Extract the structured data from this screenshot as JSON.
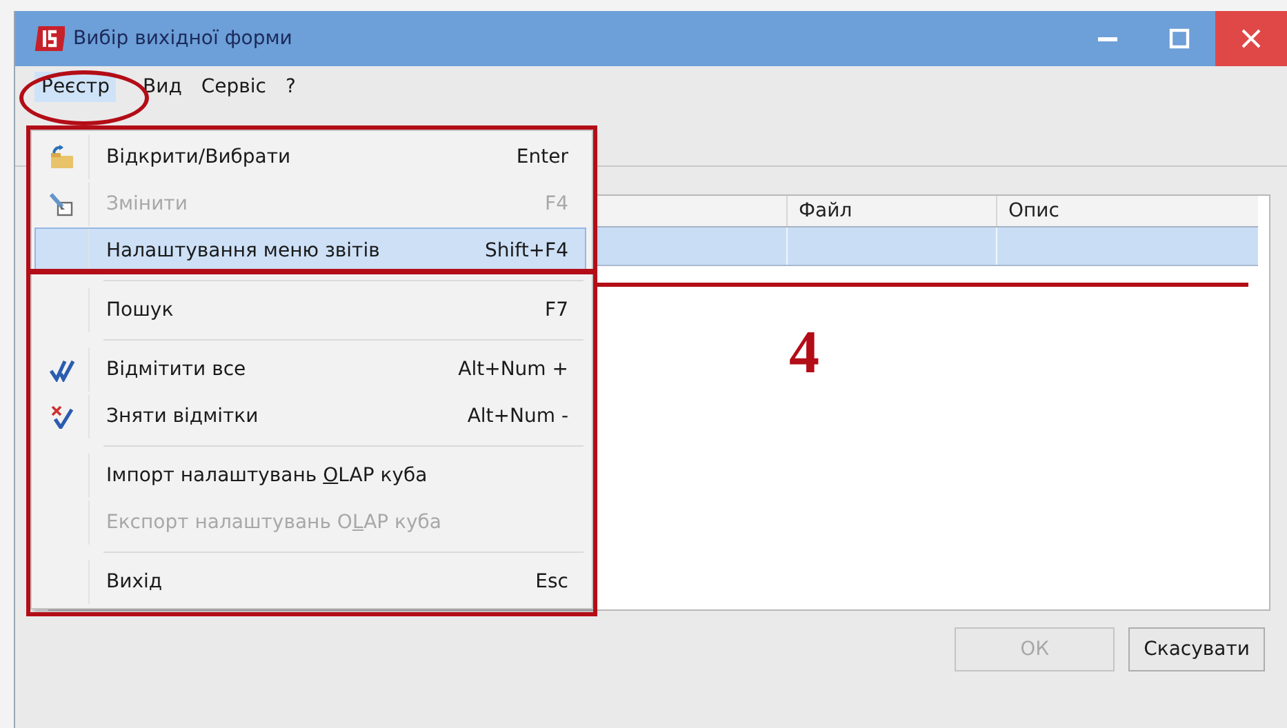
{
  "window": {
    "title": "Вибір вихідної форми"
  },
  "menu_bar": [
    {
      "label": "Реєстр",
      "selected": true
    },
    {
      "label": "Вид",
      "selected": false
    },
    {
      "label": "Сервіс",
      "selected": false
    },
    {
      "label": "?",
      "selected": false
    }
  ],
  "dropdown": {
    "items": [
      {
        "kind": "item",
        "label": "Відкрити/Вибрати",
        "shortcut": "Enter",
        "disabled": false,
        "selected": false
      },
      {
        "kind": "item",
        "label": "Змінити",
        "shortcut": "F4",
        "disabled": true,
        "selected": false
      },
      {
        "kind": "item",
        "label": "Налаштування меню звітів",
        "shortcut": "Shift+F4",
        "disabled": false,
        "selected": true
      },
      {
        "kind": "separator"
      },
      {
        "kind": "item",
        "label": "Пошук",
        "shortcut": "F7",
        "disabled": false,
        "selected": false
      },
      {
        "kind": "separator"
      },
      {
        "kind": "item",
        "label": "Відмітити все",
        "shortcut": "Alt+Num +",
        "disabled": false,
        "selected": false
      },
      {
        "kind": "item",
        "label": "Зняти відмітки",
        "shortcut": "Alt+Num -",
        "disabled": false,
        "selected": false
      },
      {
        "kind": "separator"
      },
      {
        "kind": "item",
        "label_parts": [
          {
            "text": "Імпорт налаштувань ",
            "underlined": false
          },
          {
            "text": "O",
            "underlined": true
          },
          {
            "text": "LAP куба",
            "underlined": false
          }
        ],
        "disabled": false,
        "selected": false
      },
      {
        "kind": "item",
        "label_parts": [
          {
            "text": "Експорт налаштувань O",
            "underlined": false
          },
          {
            "text": "L",
            "underlined": true
          },
          {
            "text": "AP куба",
            "underlined": false
          }
        ],
        "disabled": true,
        "selected": false
      },
      {
        "kind": "separator"
      },
      {
        "kind": "item",
        "label": "Вихід",
        "shortcut": "Esc",
        "disabled": false,
        "selected": false
      }
    ]
  },
  "table": {
    "columns": [
      "Файл",
      "Опис"
    ],
    "rows": [
      {
        "selected": true
      }
    ]
  },
  "annotation": {
    "step": "4"
  },
  "buttons": [
    {
      "label": "ОК",
      "disabled": true
    },
    {
      "label": "Скасувати",
      "disabled": false
    }
  ]
}
